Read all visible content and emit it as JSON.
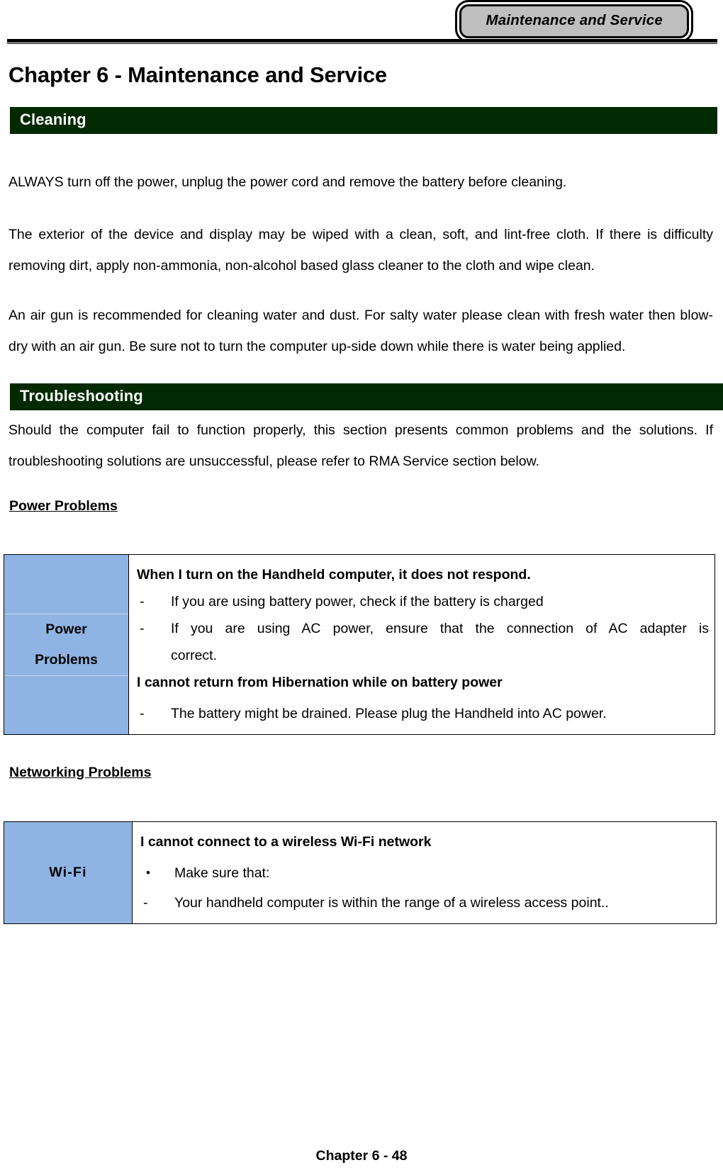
{
  "header": {
    "running_head": "Maintenance and Service"
  },
  "chapter": {
    "title": "Chapter 6  - Maintenance and Service"
  },
  "sections": {
    "cleaning": {
      "heading": "Cleaning",
      "p1": "ALWAYS turn off the power, unplug the power cord and remove the battery before cleaning.",
      "p2": "The exterior of the device and display may be wiped with a clean, soft, and lint-free cloth. If there is difficulty removing dirt, apply non-ammonia, non-alcohol based glass cleaner to the cloth and wipe clean.",
      "p3": "An air gun is recommended for cleaning water and dust. For salty water please clean with fresh water then blow-dry with an air gun. Be sure not to turn the computer up-side down while there is water being applied."
    },
    "troubleshooting": {
      "heading": "Troubleshooting",
      "p1": "Should the computer fail to function properly, this section presents common problems and the solutions. If troubleshooting solutions are unsuccessful, please refer to RMA Service section below.",
      "power_problems_heading": "Power Problems",
      "networking_problems_heading": "Networking Problems"
    }
  },
  "power_table": {
    "label_line1": "Power",
    "label_line2": "Problems",
    "title": "When I turn on the Handheld computer, it does not respond.",
    "items": [
      {
        "mark": "-",
        "text": "If you are using battery power, check if the battery is charged"
      },
      {
        "mark": "-",
        "text": "If you are using AC power, ensure that the connection of AC adapter is"
      },
      {
        "mark": "",
        "text": "correct."
      }
    ],
    "subtitle": "I cannot return from Hibernation while on battery power",
    "items2": [
      {
        "mark": "-",
        "text": "The battery might be drained. Please plug the Handheld into AC power."
      }
    ]
  },
  "wifi_table": {
    "label": "Wi-Fi",
    "title": "I cannot connect to a wireless Wi-Fi network",
    "items": [
      {
        "mark": "•",
        "text": "Make sure that:"
      },
      {
        "mark": "-",
        "text": "Your handheld computer is within the range of a wireless access point.."
      }
    ]
  },
  "footer": {
    "text": "Chapter 6 - 48"
  },
  "colors": {
    "section_bar_green": "#012a00",
    "table_label_blue": "#8fb4e3",
    "header_tab_gray": "#bfbfbf"
  }
}
